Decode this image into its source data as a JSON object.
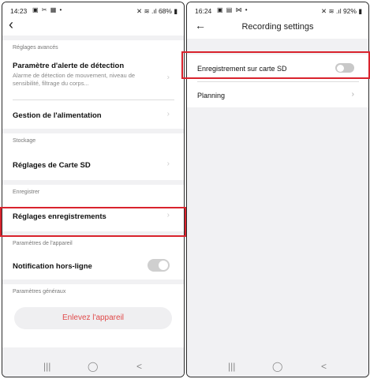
{
  "left": {
    "status": {
      "time": "14:23",
      "icons": "▣ ✂ ▦ •",
      "right": "✕ ≋ .ıl 68% ▮"
    },
    "sections": {
      "advanced": {
        "header": "Réglages avancés",
        "detection": {
          "label": "Paramètre d'alerte de détection",
          "desc": "Alarme de détection de mouvement, niveau de sensibilité, filtrage du corps..."
        },
        "power": {
          "label": "Gestion de l'alimentation"
        }
      },
      "storage": {
        "header": "Stockage",
        "sd": {
          "label": "Réglages de Carte SD"
        }
      },
      "record": {
        "header": "Enregistrer",
        "settings": {
          "label": "Réglages enregistrements"
        }
      },
      "device": {
        "header": "Paramètres de l'appareil",
        "offline": {
          "label": "Notification hors-ligne",
          "toggle_on": false
        }
      },
      "general": {
        "header": "Paramètres généraux",
        "remove_label": "Enlevez l'appareil"
      }
    }
  },
  "right": {
    "status": {
      "time": "16:24",
      "icons": "▣ ▤ ⋈ •",
      "right": "✕ ≋ .ıl 92% ▮"
    },
    "title": "Recording settings",
    "sd_recording": {
      "label": "Enregistrement sur carte SD",
      "toggle_on": false
    },
    "planning": {
      "label": "Planning"
    }
  },
  "nav": {
    "recents": "|||",
    "home": "◯",
    "back": "<"
  },
  "icons": {
    "back_left": "chevron-left-icon",
    "back_right": "arrow-left-icon",
    "row_chevron": "chevron-right-icon"
  },
  "highlight_color": "#d9232d"
}
